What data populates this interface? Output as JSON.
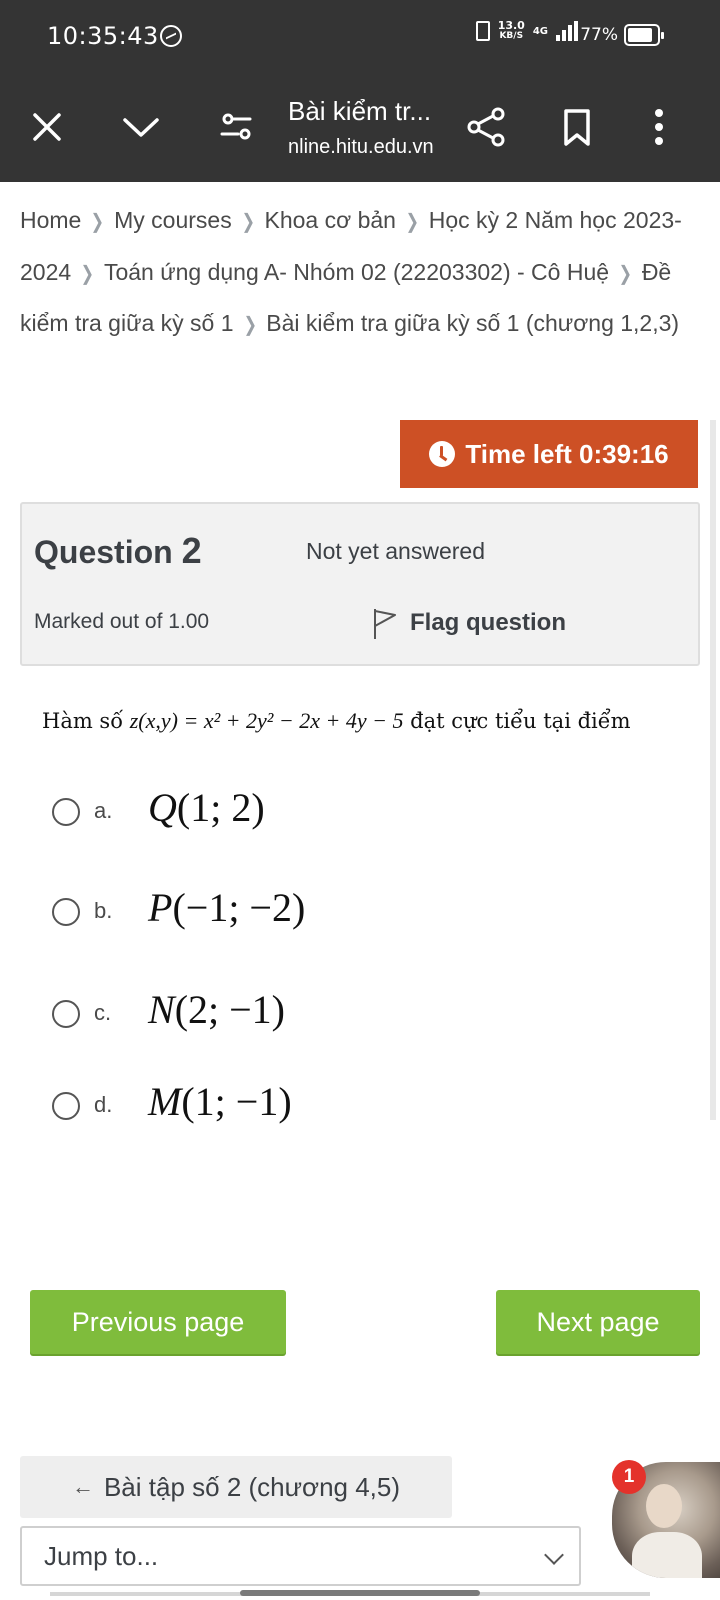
{
  "status_bar": {
    "time": "10:35:43",
    "speed_value": "13.0",
    "speed_unit": "KB/S",
    "network": "4G",
    "battery": "77%"
  },
  "browser": {
    "title": "Bài kiểm tr...",
    "url": "nline.hitu.edu.vn",
    "icons": [
      "close-icon",
      "chevron-down-icon",
      "tune-icon",
      "share-icon",
      "bookmark-icon",
      "more-vert-icon"
    ]
  },
  "breadcrumb": {
    "items": [
      "Home",
      "My courses",
      "Khoa cơ bản",
      "Học kỳ 2 Năm học 2023-2024",
      "Toán ứng dụng A- Nhóm 02 (22203302) - Cô Huệ",
      "Đề kiểm tra giữa kỳ số 1",
      "Bài kiểm tra giữa kỳ số 1 (chương 1,2,3)"
    ]
  },
  "timer": {
    "label": "Time left 0:39:16"
  },
  "question": {
    "label": "Question",
    "number": "2",
    "state": "Not yet answered",
    "grade": "Marked out of 1.00",
    "flag_label": "Flag question",
    "text_prefix": "Hàm số",
    "text_suffix": "đạt cực tiểu tại điểm",
    "formula": "z(x,y) = x² + 2y² − 2x + 4y − 5"
  },
  "answers": [
    {
      "letter": "a.",
      "point": "Q",
      "coords": "(1; 2)"
    },
    {
      "letter": "b.",
      "point": "P",
      "coords": "(−1; −2)"
    },
    {
      "letter": "c.",
      "point": "N",
      "coords": "(2; −1)"
    },
    {
      "letter": "d.",
      "point": "M",
      "coords": "(1; −1)"
    }
  ],
  "navigation": {
    "prev_label": "Previous page",
    "next_label": "Next page"
  },
  "activity_nav": {
    "prev_arrow": "←",
    "prev_label": "Bài tập số 2 (chương 4,5)",
    "jump_placeholder": "Jump to..."
  },
  "chat": {
    "badge": "1"
  }
}
